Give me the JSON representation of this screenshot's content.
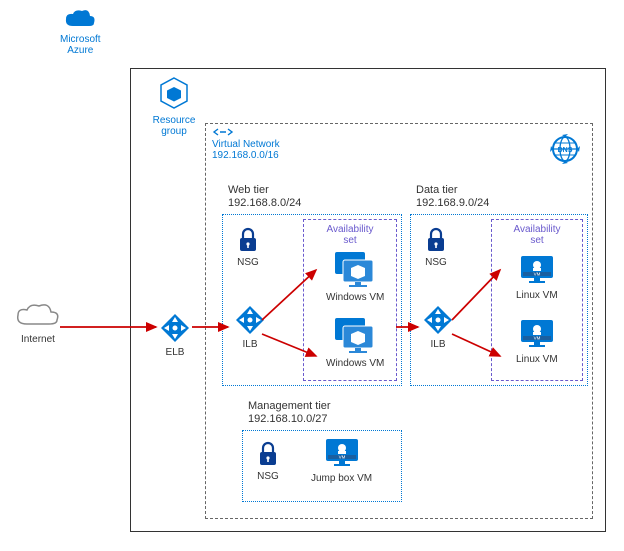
{
  "azure": {
    "label": "Microsoft\nAzure"
  },
  "resourceGroup": {
    "label": "Resource\ngroup"
  },
  "vnet": {
    "title": "Virtual Network",
    "cidr": "192.168.0.0/16"
  },
  "dns": {
    "label": "DNS"
  },
  "internet": {
    "label": "Internet"
  },
  "elb": {
    "label": "ELB"
  },
  "webTier": {
    "title": "Web tier",
    "cidr": "192.168.8.0/24",
    "nsg": "NSG",
    "ilb": "ILB",
    "avail": {
      "title": "Availability\nset",
      "vm1": "Windows VM",
      "vm2": "Windows VM"
    }
  },
  "dataTier": {
    "title": "Data tier",
    "cidr": "192.168.9.0/24",
    "nsg": "NSG",
    "ilb": "ILB",
    "avail": {
      "title": "Availability\nset",
      "vm1": "Linux VM",
      "vm2": "Linux VM"
    }
  },
  "mgmtTier": {
    "title": "Management tier",
    "cidr": "192.168.10.0/27",
    "nsg": "NSG",
    "jump": "Jump box VM"
  }
}
